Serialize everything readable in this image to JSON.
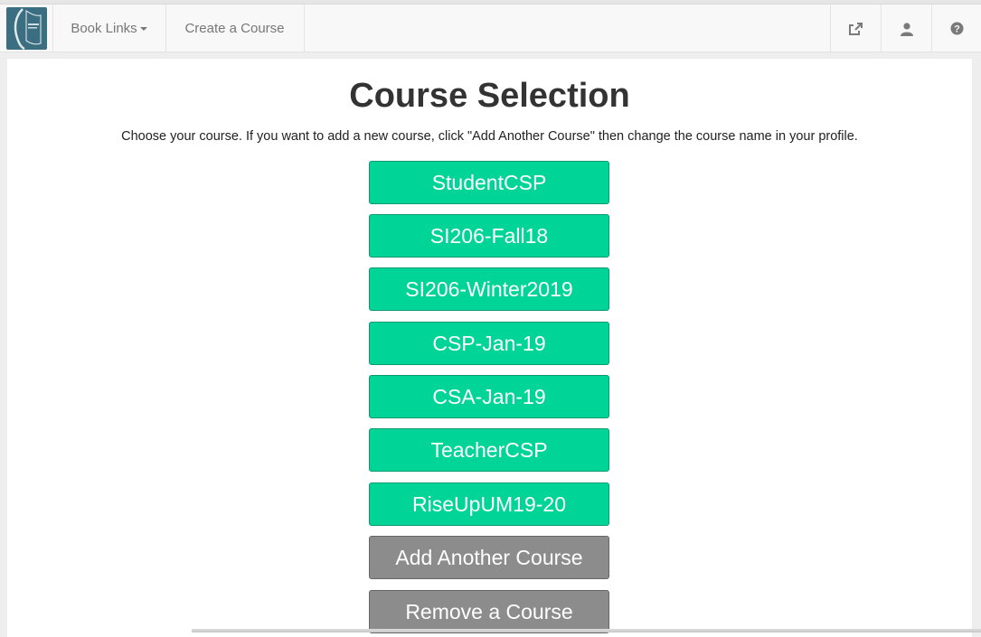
{
  "navbar": {
    "book_links_label": "Book Links",
    "create_course_label": "Create a Course",
    "icons": [
      "share-icon",
      "user-icon",
      "help-icon"
    ]
  },
  "page": {
    "title": "Course Selection",
    "subtitle": "Choose your course. If you want to add a new course, click \"Add Another Course\" then change the course name in your profile."
  },
  "courses": [
    {
      "label": "StudentCSP"
    },
    {
      "label": "SI206-Fall18"
    },
    {
      "label": "SI206-Winter2019"
    },
    {
      "label": "CSP-Jan-19"
    },
    {
      "label": "CSA-Jan-19"
    },
    {
      "label": "TeacherCSP"
    },
    {
      "label": "RiseUpUM19-20"
    }
  ],
  "actions": {
    "add_label": "Add Another Course",
    "remove_label": "Remove a Course"
  },
  "colors": {
    "course_button": "#00d497",
    "action_button": "#8c8c8c",
    "logo_bg": "#3b6e80"
  }
}
